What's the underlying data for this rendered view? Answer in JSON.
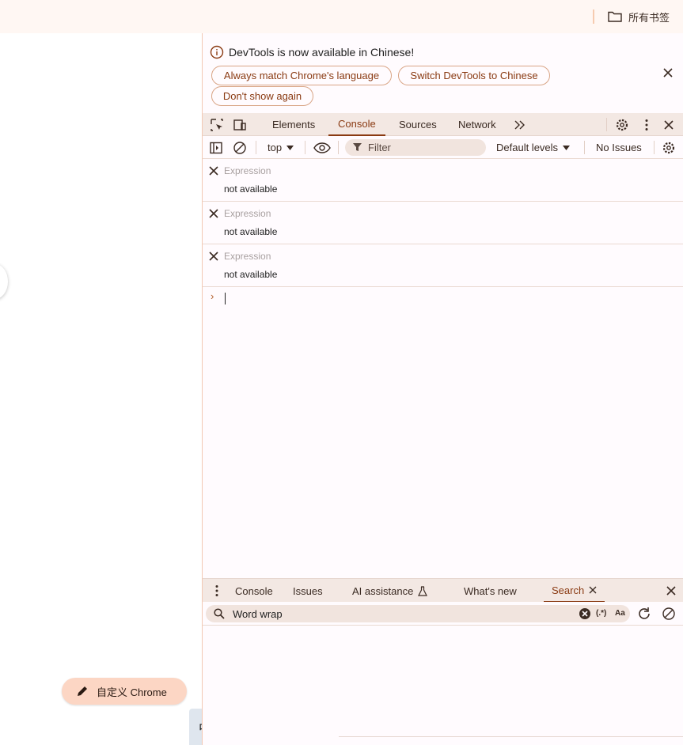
{
  "bookmarks": {
    "all_bookmarks_label": "所有书签"
  },
  "devtools": {
    "infobar": {
      "message": "DevTools is now available in Chinese!",
      "buttons": [
        "Always match Chrome's language",
        "Switch DevTools to Chinese",
        "Don't show again"
      ]
    },
    "tabs": [
      "Elements",
      "Console",
      "Sources",
      "Network"
    ],
    "active_tab": "Console",
    "console_toolbar": {
      "context": "top",
      "filter_placeholder": "Filter",
      "levels": "Default levels",
      "issues": "No Issues"
    },
    "live_expressions": [
      {
        "label": "Expression",
        "value": "not available"
      },
      {
        "label": "Expression",
        "value": "not available"
      },
      {
        "label": "Expression",
        "value": "not available"
      }
    ],
    "prompt_symbol": "›",
    "drawer": {
      "tabs": [
        "Console",
        "Issues",
        "AI assistance",
        "What's new",
        "Search"
      ],
      "active_tab": "Search",
      "search": {
        "value": "Word wrap",
        "regex_label": "(.*)",
        "case_label": "Aa"
      }
    }
  },
  "page": {
    "customize_button": "自定义 Chrome",
    "ime": {
      "mode": "中",
      "punct": "°,"
    }
  },
  "colors": {
    "accent": "#8a3a12",
    "pill_border": "#d9a586",
    "tab_bg": "#f3e8e3",
    "customize_bg": "#fcd6c4"
  }
}
